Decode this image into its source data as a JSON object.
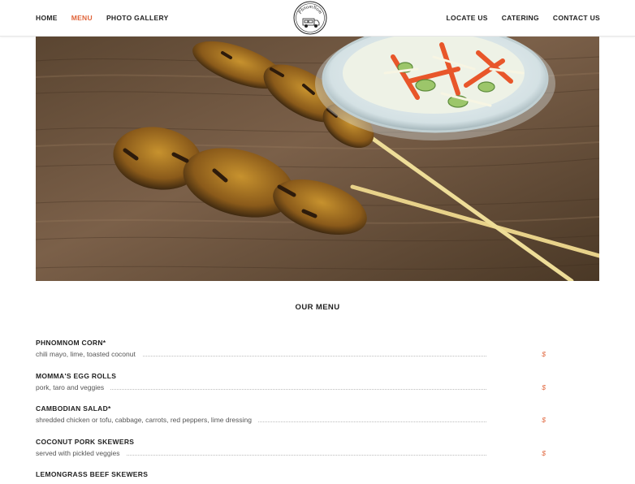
{
  "brand": {
    "logo_text": "PhnomNom"
  },
  "nav": {
    "left": [
      {
        "label": "HOME",
        "active": false
      },
      {
        "label": "MENU",
        "active": true
      },
      {
        "label": "PHOTO GALLERY",
        "active": false
      }
    ],
    "right": [
      {
        "label": "LOCATE US",
        "active": false
      },
      {
        "label": "CATERING",
        "active": false
      },
      {
        "label": "CONTACT US",
        "active": false
      }
    ]
  },
  "menu": {
    "title": "OUR MENU",
    "items": [
      {
        "name": "PHNOMNOM CORN*",
        "description": "chili mayo, lime, toasted coconut",
        "price": "$"
      },
      {
        "name": "MOMMA'S EGG ROLLS",
        "description": "pork, taro and veggies",
        "price": "$"
      },
      {
        "name": "CAMBODIAN SALAD*",
        "description": "shredded chicken or tofu, cabbage, carrots, red peppers, lime dressing",
        "price": "$"
      },
      {
        "name": "COCONUT PORK SKEWERS",
        "description": "served with pickled veggies",
        "price": "$"
      },
      {
        "name": "LEMONGRASS BEEF SKEWERS",
        "description": "",
        "price": ""
      }
    ]
  },
  "colors": {
    "accent": "#e0643a",
    "text": "#222222",
    "muted": "#555555"
  }
}
